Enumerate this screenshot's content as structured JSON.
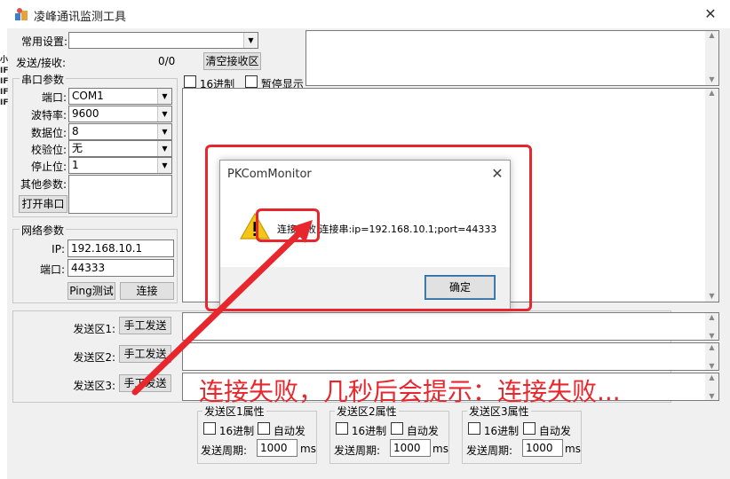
{
  "window": {
    "title": "凌峰通讯监测工具",
    "close": "✕"
  },
  "left_strip": [
    "小",
    "IF",
    "IF",
    "IF",
    "IF"
  ],
  "common_settings": {
    "label": "常用设置:",
    "value": ""
  },
  "send_recv": {
    "label": "发送/接收:",
    "count": "0/0",
    "clear_button": "清空接收区"
  },
  "recv_options": {
    "hex_label": "16进制",
    "pause_label": "暂停显示"
  },
  "serial": {
    "group_title": "串口参数",
    "port": {
      "label": "端口:",
      "value": "COM1"
    },
    "baud": {
      "label": "波特率:",
      "value": "9600"
    },
    "databits": {
      "label": "数据位:",
      "value": "8"
    },
    "parity": {
      "label": "校验位:",
      "value": "无"
    },
    "stopbits": {
      "label": "停止位:",
      "value": "1"
    },
    "other": {
      "label": "其他参数:"
    },
    "open_button": "打开串口"
  },
  "network": {
    "group_title": "网络参数",
    "ip": {
      "label": "IP:",
      "value": "192.168.10.1"
    },
    "port": {
      "label": "端口:",
      "value": "44333"
    },
    "ping_button": "Ping测试",
    "connect_button": "连接"
  },
  "send_areas": [
    {
      "label": "发送区1:",
      "button": "手工发送"
    },
    {
      "label": "发送区2:",
      "button": "手工发送"
    },
    {
      "label": "发送区3:",
      "button": "手工发送"
    }
  ],
  "send_props": [
    {
      "title": "发送区1属性",
      "hex": "16进制",
      "auto": "自动发",
      "period_label": "发送周期:",
      "period": "1000",
      "unit": "ms"
    },
    {
      "title": "发送区2属性",
      "hex": "16进制",
      "auto": "自动发",
      "period_label": "发送周期:",
      "period": "1000",
      "unit": "ms"
    },
    {
      "title": "发送区3属性",
      "hex": "16进制",
      "auto": "自动发",
      "period_label": "发送周期:",
      "period": "1000",
      "unit": "ms"
    }
  ],
  "dialog": {
    "title": "PKComMonitor",
    "message": "连接失败,连接串:ip=192.168.10.1;port=44333",
    "ok_button": "确定",
    "close": "✕"
  },
  "annotation": {
    "text": "连接失败，几秒后会提示：连接失败...",
    "color": "#e8262d"
  }
}
